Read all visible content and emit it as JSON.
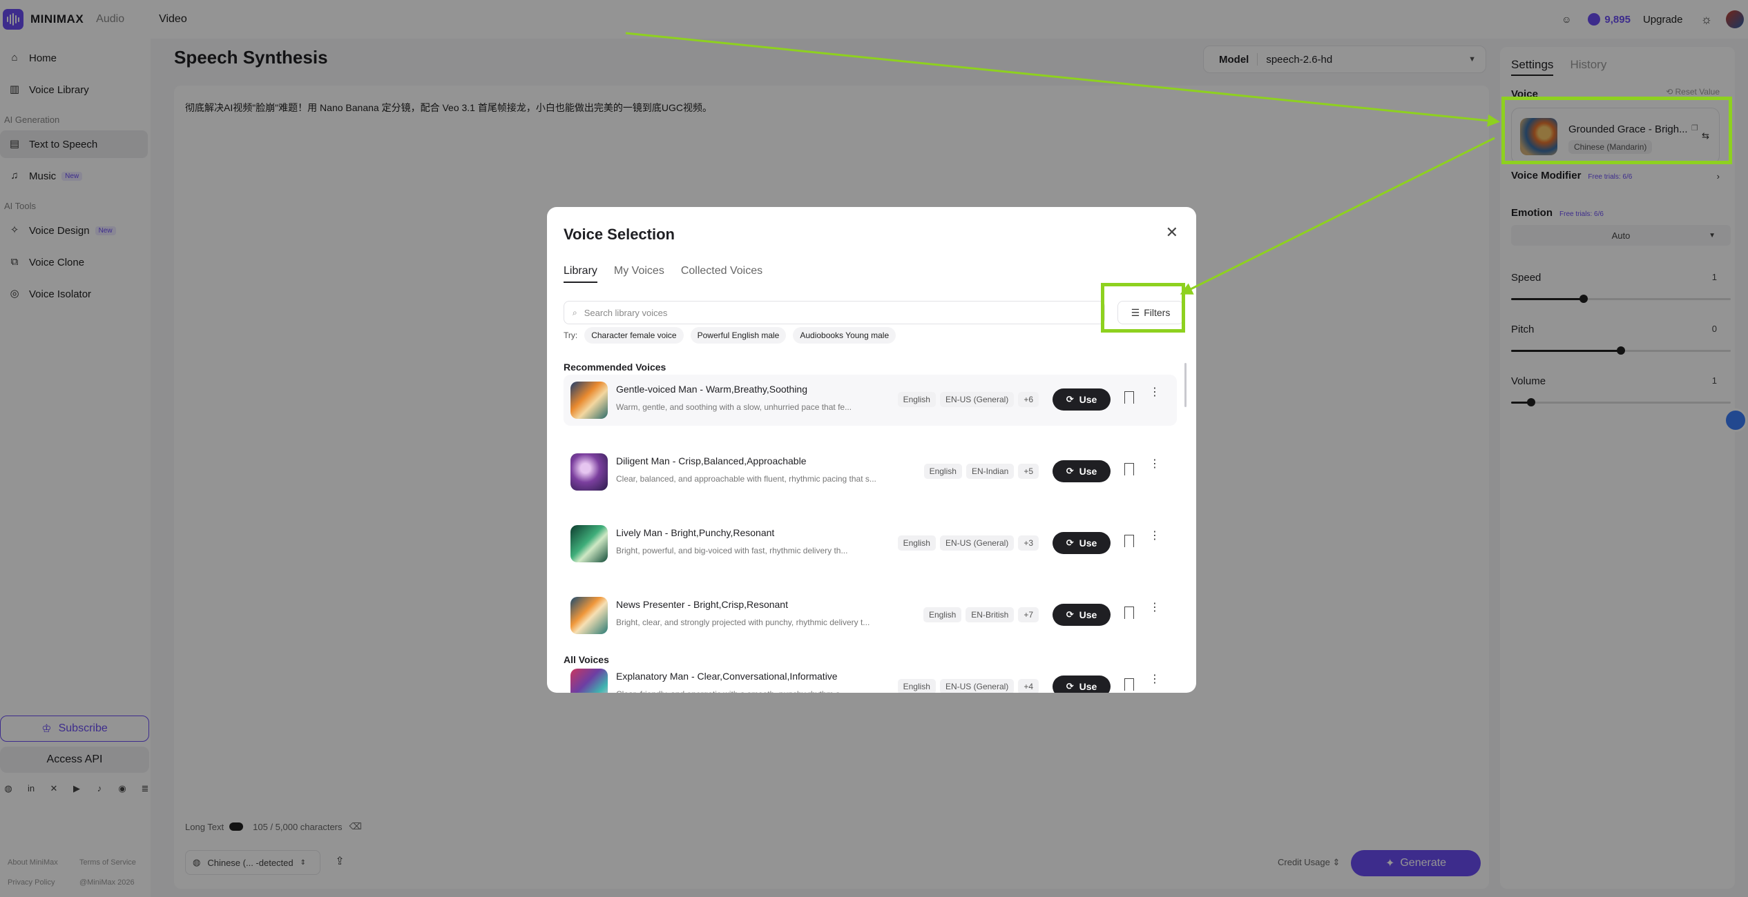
{
  "topbar": {
    "brand": "MINIMAX",
    "nav": [
      "Audio",
      "Video"
    ],
    "credits": "9,895",
    "upgrade": "Upgrade"
  },
  "sidebar": {
    "items": [
      {
        "label": "Home",
        "icon": "home-icon"
      },
      {
        "label": "Voice Library",
        "icon": "library-icon"
      }
    ],
    "section_ai_generation": "AI Generation",
    "generation_items": [
      {
        "label": "Text to Speech",
        "icon": "tts-icon",
        "active": true
      },
      {
        "label": "Music",
        "icon": "music-icon",
        "badge": "New"
      }
    ],
    "section_ai_tools": "AI Tools",
    "tool_items": [
      {
        "label": "Voice Design",
        "icon": "voice-design-icon",
        "badge": "New"
      },
      {
        "label": "Voice Clone",
        "icon": "voice-clone-icon"
      },
      {
        "label": "Voice Isolator",
        "icon": "voice-isolator-icon"
      }
    ],
    "subscribe": "Subscribe",
    "access_api": "Access API",
    "footer": {
      "about": "About MiniMax",
      "terms": "Terms of Service",
      "privacy": "Privacy Policy",
      "copyright": "@MiniMax 2026"
    }
  },
  "main": {
    "title": "Speech Synthesis",
    "model_label": "Model",
    "model_value": "speech-2.6-hd",
    "editor_text": "彻底解决AI视频\"脸崩\"难题！用 Nano Banana 定分镜，配合 Veo 3.1 首尾帧接龙，小白也能做出完美的一镜到底UGC视频。",
    "long_text": "Long Text",
    "char_count": "105 / 5,000 characters",
    "language": "Chinese (... -detected",
    "credit_usage": "Credit Usage",
    "generate": "Generate"
  },
  "settings": {
    "tab_settings": "Settings",
    "tab_history": "History",
    "voice_label": "Voice",
    "reset": "Reset Value",
    "voice_name": "Grounded Grace - Brigh...",
    "voice_lang": "Chinese (Mandarin)",
    "voice_modifier": "Voice Modifier",
    "free_trials_modifier": "Free trials: 6/6",
    "emotion": "Emotion",
    "free_trials_emotion": "Free trials: 6/6",
    "emotion_value": "Auto",
    "speed": "Speed",
    "speed_value": "1",
    "speed_level": 0.33,
    "pitch": "Pitch",
    "pitch_value": "0",
    "pitch_level": 0.5,
    "volume": "Volume",
    "volume_value": "1",
    "volume_level": 0.09
  },
  "modal": {
    "title": "Voice Selection",
    "tabs": [
      "Library",
      "My Voices",
      "Collected Voices"
    ],
    "search_placeholder": "Search library voices",
    "filters": "Filters",
    "try_label": "Try:",
    "try_chips": [
      "Character female voice",
      "Powerful English male",
      "Audiobooks Young male"
    ],
    "recommended": "Recommended Voices",
    "all_voices": "All Voices",
    "use_label": "Use",
    "voices": [
      {
        "name": "Gentle-voiced Man - Warm,Breathy,Soothing",
        "desc": "Warm, gentle, and soothing with a slow, unhurried pace that fe...",
        "tags": [
          "English",
          "EN-US (General)",
          "+6"
        ]
      },
      {
        "name": "Diligent Man - Crisp,Balanced,Approachable",
        "desc": "Clear, balanced, and approachable with fluent, rhythmic pacing that s...",
        "tags": [
          "English",
          "EN-Indian",
          "+5"
        ]
      },
      {
        "name": "Lively Man - Bright,Punchy,Resonant",
        "desc": "Bright, powerful, and big-voiced with fast, rhythmic delivery th...",
        "tags": [
          "English",
          "EN-US (General)",
          "+3"
        ]
      },
      {
        "name": "News Presenter - Bright,Crisp,Resonant",
        "desc": "Bright, clear, and strongly projected with punchy, rhythmic delivery t...",
        "tags": [
          "English",
          "EN-British",
          "+7"
        ]
      },
      {
        "name": "Explanatory Man - Clear,Conversational,Informative",
        "desc": "Clear, friendly, and energetic with a smooth, punchy rhythm a...",
        "tags": [
          "English",
          "EN-US (General)",
          "+4"
        ]
      }
    ]
  },
  "colors": {
    "accent": "#6a4df2",
    "annotation": "#8ed11f"
  }
}
